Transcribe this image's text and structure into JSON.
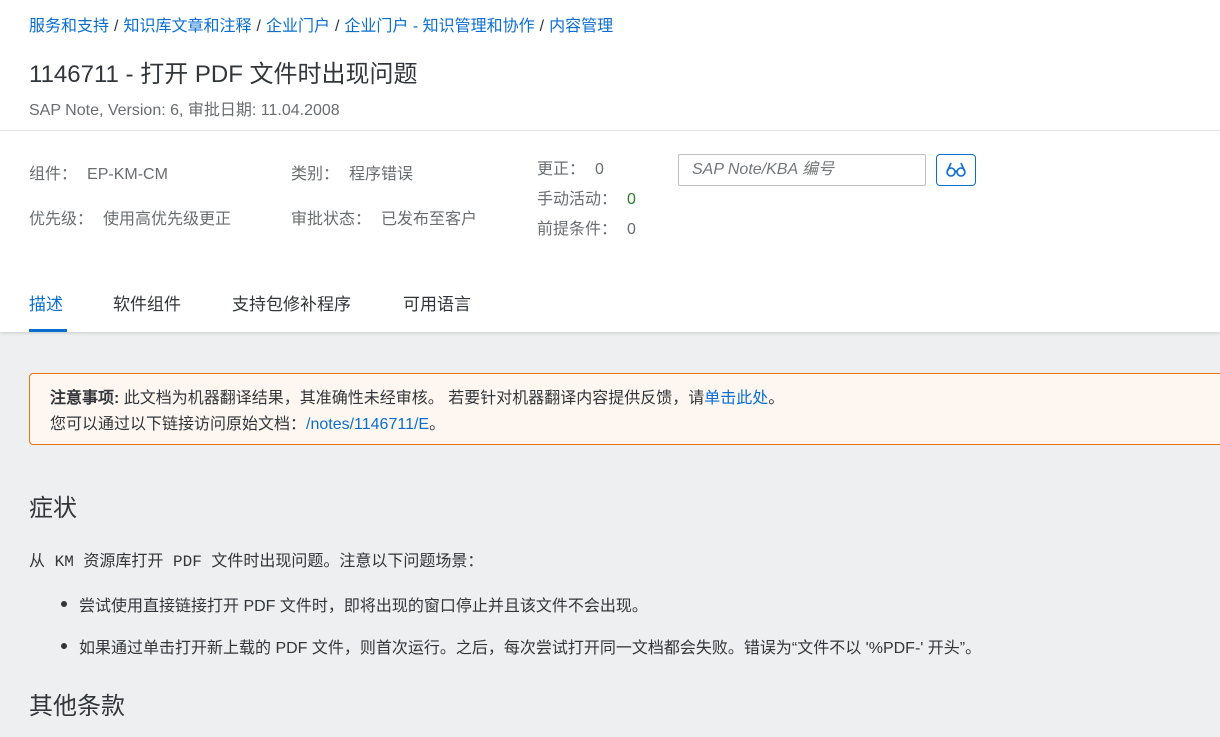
{
  "breadcrumb": {
    "items": [
      "服务和支持",
      "知识库文章和注释",
      "企业门户",
      "企业门户 - 知识管理和协作",
      "内容管理"
    ],
    "separator": "/"
  },
  "note": {
    "title": "1146711 - 打开 PDF 文件时出现问题",
    "subtitle": "SAP Note, Version: 6, 审批日期: 11.04.2008"
  },
  "attributes": {
    "component_label": "组件：",
    "component_value": "EP-KM-CM",
    "priority_label": "优先级：",
    "priority_value": "使用高优先级更正",
    "category_label": "类别：",
    "category_value": "程序错误",
    "approval_label": "审批状态：",
    "approval_value": "已发布至客户",
    "corrections_label": "更正：",
    "corrections_value": "0",
    "manual_label": "手动活动：",
    "manual_value": "0",
    "prereq_label": "前提条件：",
    "prereq_value": "0"
  },
  "search": {
    "placeholder": "SAP Note/KBA 编号",
    "value": ""
  },
  "tabs": [
    {
      "label": "描述",
      "active": true
    },
    {
      "label": "软件组件",
      "active": false
    },
    {
      "label": "支持包修补程序",
      "active": false
    },
    {
      "label": "可用语言",
      "active": false
    }
  ],
  "notice": {
    "bold_label": "注意事项:",
    "text1": " 此文档为机器翻译结果，其准确性未经审核。  若要针对机器翻译内容提供反馈，请",
    "link1": "单击此处",
    "text1_end": "。",
    "text2": "您可以通过以下链接访问原始文档：",
    "link2": "/notes/1146711/E",
    "text2_end": "。"
  },
  "content": {
    "symptom_heading": "症状",
    "symptom_intro": "从 KM 资源库打开 PDF 文件时出现问题。注意以下问题场景：",
    "bullets": [
      "尝试使用直接链接打开 PDF 文件时，即将出现的窗口停止并且该文件不会出现。",
      "如果通过单击打开新上载的 PDF 文件，则首次运行。之后，每次尝试打开同一文档都会失败。错误为“文件不以 '%PDF-' 开头”。"
    ],
    "other_heading": "其他条款"
  },
  "colors": {
    "link": "#0a6ed1",
    "notice_border": "#e9730c",
    "notice_bg": "#fef7f1",
    "green_value": "#2b7d2b",
    "page_bg": "#edeff0"
  },
  "icons": {
    "search_button": "glasses-icon"
  }
}
